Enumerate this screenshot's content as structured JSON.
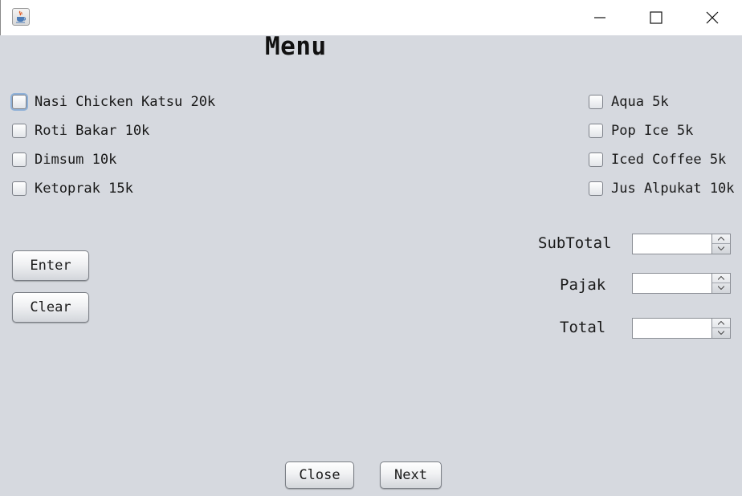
{
  "window": {
    "app_icon": "java-coffee-cup-icon",
    "controls": {
      "minimize_icon": "minimize-icon",
      "maximize_icon": "maximize-icon",
      "close_icon": "close-icon"
    }
  },
  "title": "Menu",
  "food_items": [
    {
      "label": "Nasi Chicken Katsu 20k",
      "checked": false,
      "focused": true
    },
    {
      "label": "Roti Bakar 10k",
      "checked": false
    },
    {
      "label": "Dimsum 10k",
      "checked": false
    },
    {
      "label": "Ketoprak 15k",
      "checked": false
    }
  ],
  "drink_items": [
    {
      "label": "Aqua 5k",
      "checked": false
    },
    {
      "label": "Pop Ice 5k",
      "checked": false
    },
    {
      "label": "Iced Coffee 5k",
      "checked": false
    },
    {
      "label": "Jus Alpukat 10k",
      "checked": false
    }
  ],
  "buttons": {
    "enter": "Enter",
    "clear": "Clear",
    "close": "Close",
    "next": "Next"
  },
  "totals": {
    "subtotal_label": "SubTotal",
    "subtotal_value": "",
    "pajak_label": "Pajak",
    "pajak_value": "",
    "total_label": "Total",
    "total_value": ""
  }
}
